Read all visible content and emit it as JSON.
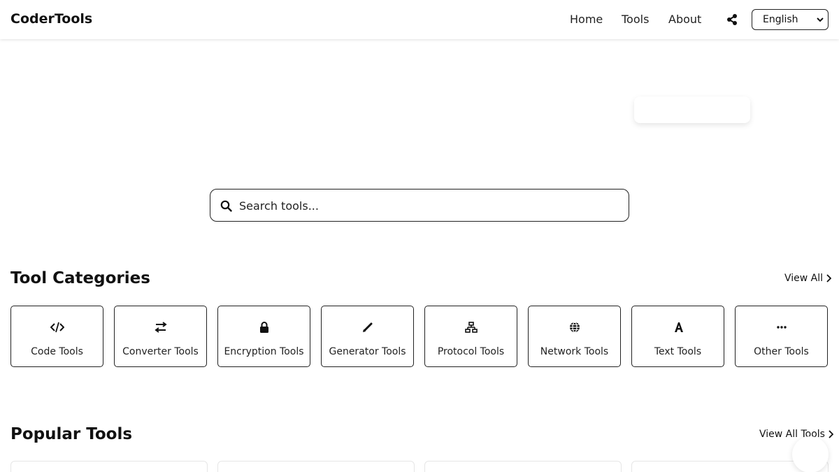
{
  "header": {
    "brand": "CoderTools",
    "nav": [
      {
        "label": "Home"
      },
      {
        "label": "Tools"
      },
      {
        "label": "About"
      }
    ],
    "share_icon": "share-icon",
    "language": {
      "selected": "English"
    }
  },
  "search": {
    "placeholder": "Search tools...",
    "value": ""
  },
  "categories": {
    "title": "Tool Categories",
    "view_all": "View All",
    "items": [
      {
        "label": "Code Tools",
        "icon": "code-icon"
      },
      {
        "label": "Converter Tools",
        "icon": "arrows-exchange-icon"
      },
      {
        "label": "Encryption Tools",
        "icon": "lock-icon"
      },
      {
        "label": "Generator Tools",
        "icon": "pen-icon"
      },
      {
        "label": "Protocol Tools",
        "icon": "network-diagram-icon"
      },
      {
        "label": "Network Tools",
        "icon": "globe-icon"
      },
      {
        "label": "Text Tools",
        "icon": "font-icon"
      },
      {
        "label": "Other Tools",
        "icon": "ellipsis-icon"
      }
    ]
  },
  "popular": {
    "title": "Popular Tools",
    "view_all": "View All Tools"
  }
}
